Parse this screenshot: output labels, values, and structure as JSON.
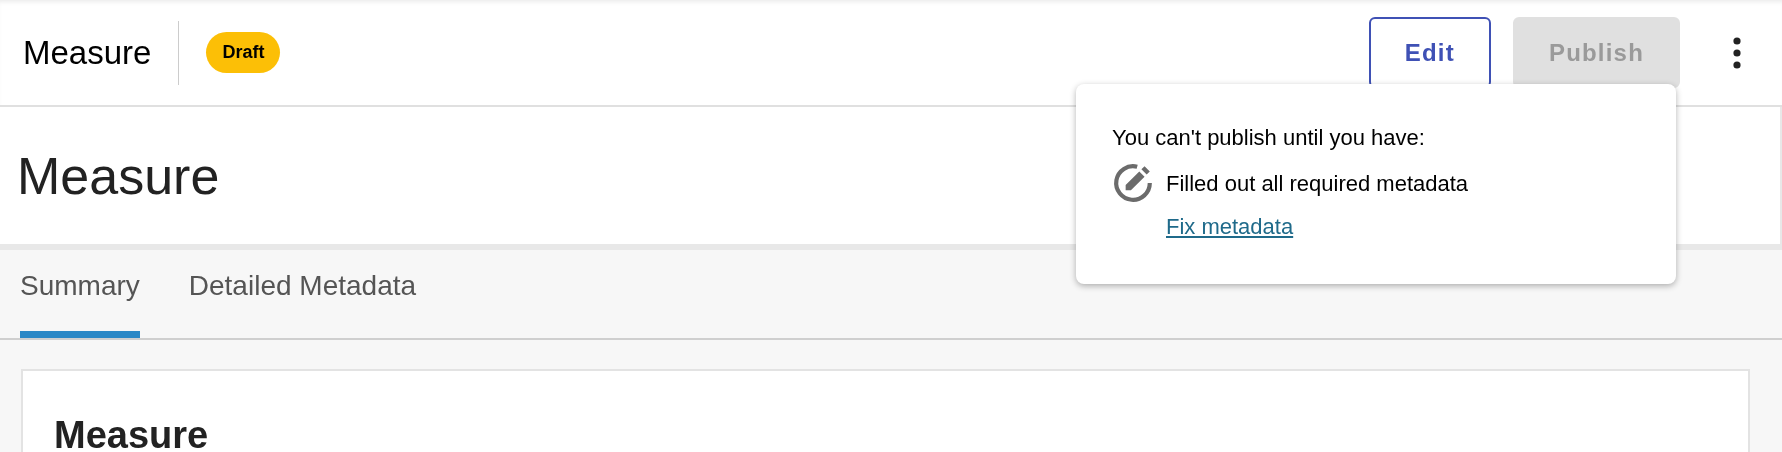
{
  "header": {
    "title": "Measure",
    "badge": "Draft"
  },
  "actions": [
    {
      "label": "Edit",
      "disabled": false
    },
    {
      "label": "Publish",
      "disabled": true
    }
  ],
  "popover": {
    "heading": "You can't publish until you have:",
    "requirement": "Filled out all required metadata",
    "link": "Fix metadata"
  },
  "page_title": "Measure",
  "tabs": [
    {
      "label": "Summary",
      "selected": true
    },
    {
      "label": "Detailed Metadata",
      "selected": false
    }
  ],
  "card": {
    "heading": "Measure"
  }
}
